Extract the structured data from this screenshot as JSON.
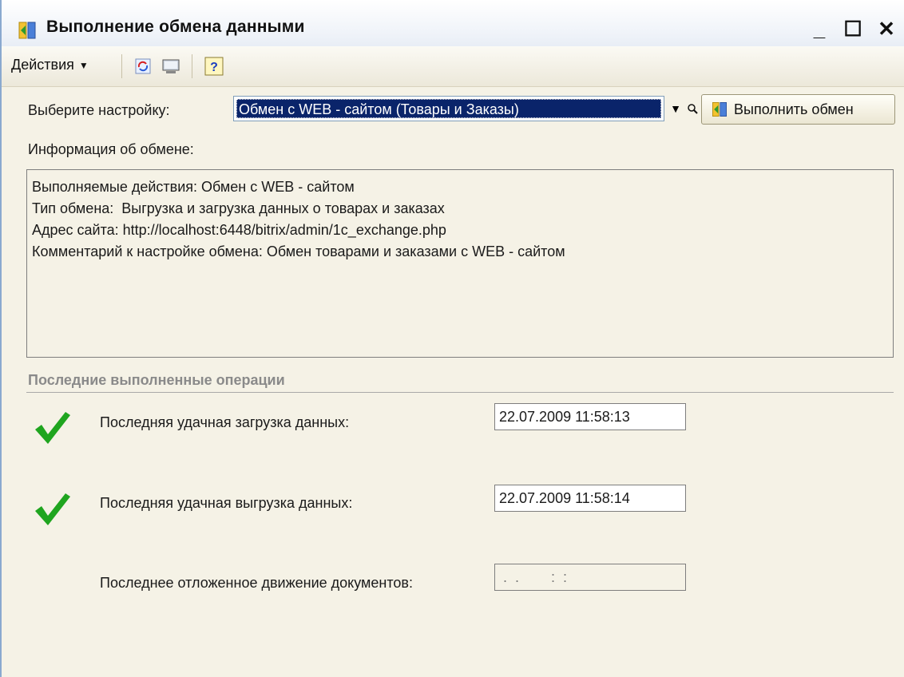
{
  "window": {
    "title": "Выполнение обмена данными",
    "controls": {
      "minimize": "_",
      "maximize": "☐",
      "close": "✕"
    }
  },
  "toolbar": {
    "actions_label": "Действия",
    "icons": [
      "refresh-icon",
      "monitor-icon",
      "help-icon"
    ],
    "help_glyph": "?"
  },
  "setting": {
    "label": "Выберите настройку:",
    "value": "Обмен с WEB - сайтом (Товары и Заказы)",
    "execute_label": "Выполнить обмен"
  },
  "info": {
    "label": "Информация об обмене:",
    "lines": [
      "Выполняемые действия: Обмен с WEB - сайтом",
      "Тип обмена:  Выгрузка и загрузка данных о товарах и заказах",
      "Адрес сайта: http://localhost:6448/bitrix/admin/1c_exchange.php",
      "",
      "Комментарий к настройке обмена: Обмен товарами и заказами с WEB - сайтом"
    ]
  },
  "last_operations": {
    "title": "Последние выполненные операции",
    "rows": [
      {
        "label": "Последняя удачная загрузка данных:",
        "value": "22.07.2009 11:58:13",
        "status": "success"
      },
      {
        "label": "Последняя удачная выгрузка данных:",
        "value": "22.07.2009 11:58:14",
        "status": "success"
      },
      {
        "label": "Последнее отложенное движение документов:",
        "value": " .  .        :  :",
        "status": "none"
      }
    ]
  },
  "colors": {
    "success": "#1fa51f",
    "selection": "#0a246a",
    "panel_bg": "#f5f2e6"
  }
}
